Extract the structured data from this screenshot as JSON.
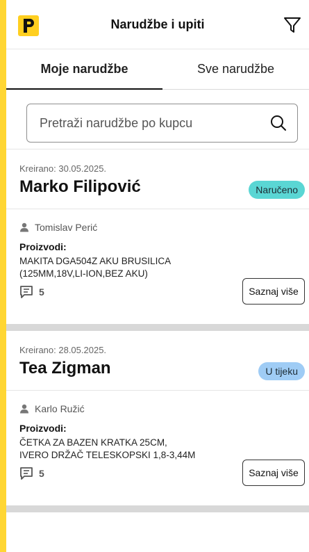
{
  "header": {
    "title": "Narudžbe i upiti",
    "logo_text": "P"
  },
  "tabs": [
    {
      "label": "Moje narudžbe",
      "active": true
    },
    {
      "label": "Sve narudžbe",
      "active": false
    }
  ],
  "search": {
    "placeholder": "Pretraži narudžbe po kupcu",
    "value": ""
  },
  "orders": [
    {
      "created": "Kreirano: 30.05.2025.",
      "customer": "Marko Filipović",
      "status": "Naručeno",
      "status_color": "#5ad6d4",
      "agent": "Tomislav Perić",
      "products_label": "Proizvodi:",
      "products": [
        "MAKITA DGA504Z AKU BRUSILICA",
        "(125MM,18V,LI-ION,BEZ AKU)"
      ],
      "comments": "5",
      "more_label": "Saznaj više"
    },
    {
      "created": "Kreirano: 28.05.2025.",
      "customer": "Tea Zigman",
      "status": "U tijeku",
      "status_color": "#9fccf5",
      "agent": "Karlo Ružić",
      "products_label": "Proizvodi:",
      "products": [
        "ČETKA ZA BAZEN KRATKA 25CM,",
        "IVERO DRŽAČ TELESKOPSKI 1,8-3,44M"
      ],
      "comments": "5",
      "more_label": "Saznaj više"
    }
  ],
  "colors": {
    "accent": "#ffd633",
    "logo_bg": "#ffcf20",
    "separator": "#d8d8d8"
  }
}
